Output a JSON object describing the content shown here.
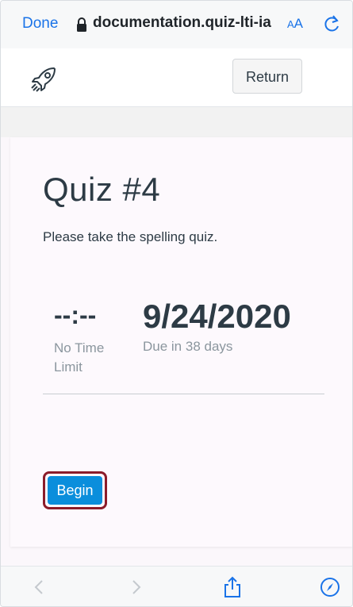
{
  "browser": {
    "done_label": "Done",
    "url": "documentation.quiz-lti-ia",
    "text_size_label_small": "A",
    "text_size_label_large": "A",
    "accent_color": "#1a73e8"
  },
  "header": {
    "logo_icon": "rocket-icon",
    "return_label": "Return"
  },
  "quiz": {
    "title": "Quiz #4",
    "description": "Please take the spelling quiz.",
    "time_limit_value": "--:--",
    "time_limit_label": "No Time Limit",
    "due_date": "9/24/2020",
    "due_label": "Due in 38 days",
    "begin_label": "Begin",
    "begin_color": "#0a8edc",
    "focus_ring_color": "#8b1c2a"
  },
  "toolbar": {
    "icons": [
      "back-icon",
      "forward-icon",
      "share-icon",
      "compass-icon"
    ]
  }
}
